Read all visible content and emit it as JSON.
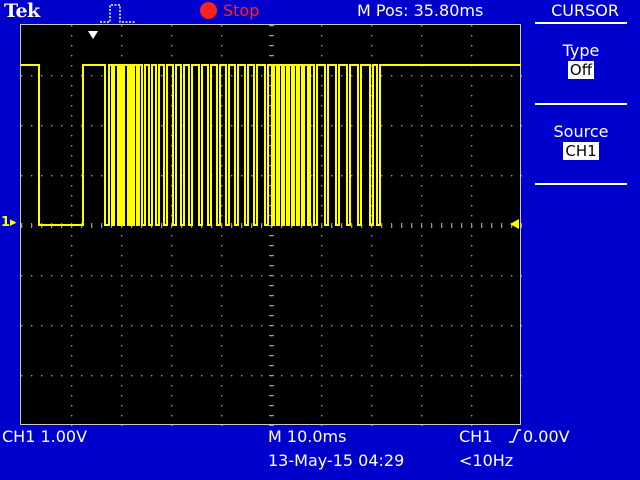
{
  "header": {
    "brand": "Tek",
    "acquisition_icon": "pulse-trigger-icon",
    "run_status": "Stop",
    "run_status_color": "#ff2020",
    "horizontal_position": "M Pos: 35.80ms"
  },
  "menu": {
    "title": "CURSOR",
    "items": [
      {
        "label": "Type",
        "value": "Off"
      },
      {
        "label": "Source",
        "value": "CH1"
      }
    ]
  },
  "graticule": {
    "ch1_marker": "1",
    "trace_color": "#ffff00",
    "background": "#000000"
  },
  "footer": {
    "ch1_scale": "CH1  1.00V",
    "timebase": "M 10.0ms",
    "datetime": "13-May-15 04:29",
    "trigger_source": "CH1",
    "trigger_slope_icon": "rising-edge-icon",
    "trigger_level": "0.00V",
    "trigger_frequency": "<10Hz"
  },
  "colors": {
    "screen_bg": "#0000cc",
    "text": "#ffffff",
    "trace": "#ffff00"
  }
}
